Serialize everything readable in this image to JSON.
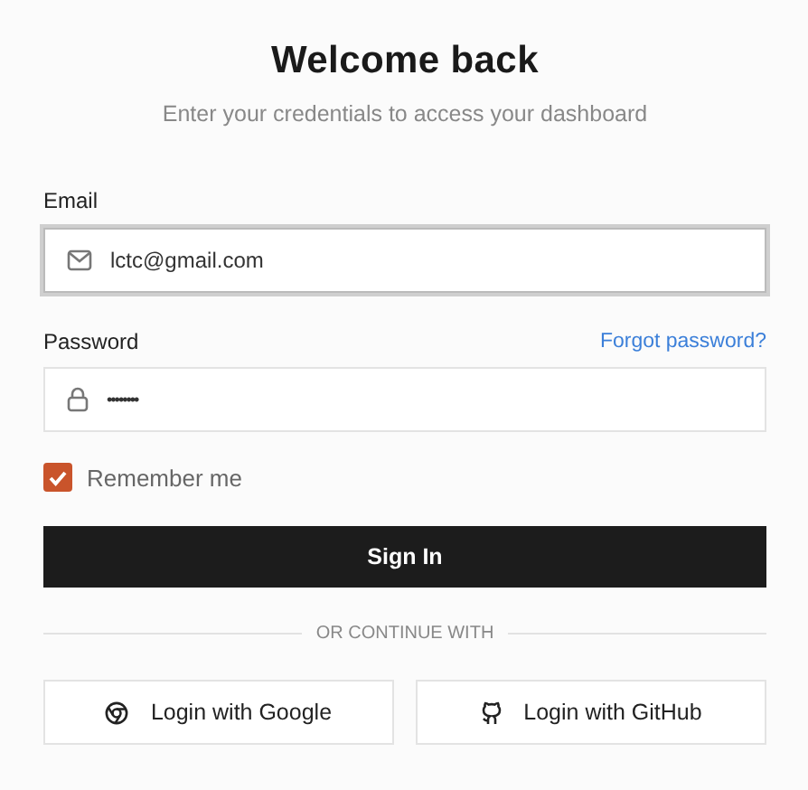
{
  "title": "Welcome back",
  "subtitle": "Enter your credentials to access your dashboard",
  "email": {
    "label": "Email",
    "value": "lctc@gmail.com",
    "focused": true
  },
  "password": {
    "label": "Password",
    "value": "••••••••",
    "forgot_link": "Forgot password?"
  },
  "remember": {
    "label": "Remember me",
    "checked": true
  },
  "submit": "Sign In",
  "divider": "OR CONTINUE WITH",
  "social": [
    {
      "kind": "google",
      "label": "Login with Google"
    },
    {
      "kind": "github",
      "label": "Login with GitHub"
    }
  ]
}
